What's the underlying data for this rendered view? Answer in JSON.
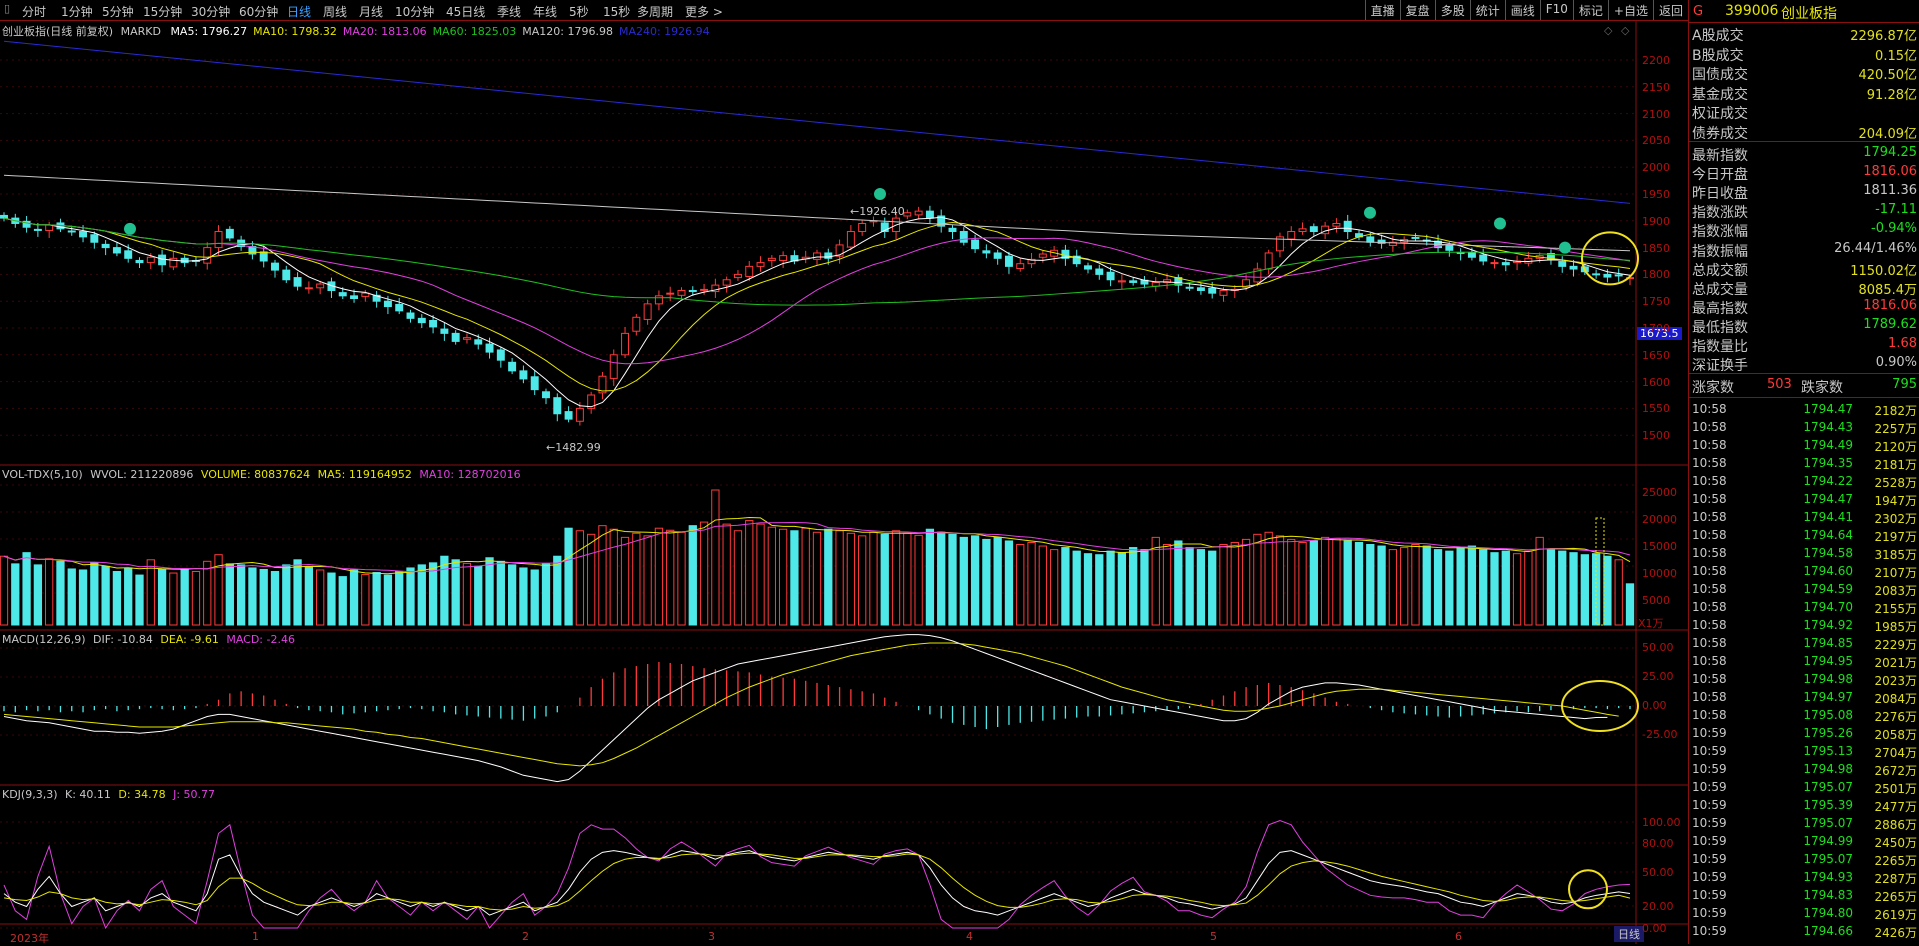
{
  "topbar": {
    "timeframes": [
      "分时",
      "1分钟",
      "5分钟",
      "15分钟",
      "30分钟",
      "60分钟",
      "日线",
      "周线",
      "月线",
      "10分钟",
      "45日线",
      "季线",
      "年线",
      "5秒",
      "15秒",
      "多周期",
      "更多 >"
    ],
    "selected": "日线",
    "tools": [
      "直播",
      "复盘",
      "多股",
      "统计",
      "画线",
      "F10",
      "标记",
      "+自选",
      "返回"
    ]
  },
  "main": {
    "title": "创业板指(日线 前复权)",
    "indicator": "MARKD",
    "ma": [
      {
        "label": "MA5: 1796.27",
        "color": "#ffffff"
      },
      {
        "label": "MA10: 1798.32",
        "color": "#e6e600"
      },
      {
        "label": "MA20: 1813.06",
        "color": "#e040e0"
      },
      {
        "label": "MA60: 1825.03",
        "color": "#20c020"
      },
      {
        "label": "MA120: 1796.98",
        "color": "#c8c8c8"
      },
      {
        "label": "MA240: 1926.94",
        "color": "#2a2ad0"
      }
    ],
    "y_ticks": [
      "2200",
      "2150",
      "2100",
      "2050",
      "2000",
      "1950",
      "1900",
      "1850",
      "1800",
      "1750",
      "1700",
      "1650",
      "1600",
      "1550",
      "1500"
    ],
    "high_label": "1926.40",
    "low_label": "1482.99",
    "cursor_price": "1673.5"
  },
  "vol": {
    "title": "VOL-TDX(5,10)",
    "wvol": "WVOL: 211220896",
    "volume": "VOLUME: 80837624",
    "ma5": "MA5: 119164952",
    "ma10": "MA10: 128702016",
    "y_ticks": [
      "25000",
      "20000",
      "15000",
      "10000",
      "5000"
    ],
    "unit": "X1万"
  },
  "macd": {
    "title": "MACD(12,26,9)",
    "dif": "DIF: -10.84",
    "dea": "DEA: -9.61",
    "macd": "MACD: -2.46",
    "y_ticks": [
      "50.00",
      "25.00",
      "0.00",
      "-25.00"
    ]
  },
  "kdj": {
    "title": "KDJ(9,3,3)",
    "k": "K: 40.11",
    "d": "D: 34.78",
    "j": "J: 50.77",
    "y_ticks": [
      "100.00",
      "80.00",
      "50.00",
      "20.00",
      "0.00"
    ]
  },
  "xaxis": {
    "labels": [
      "2023年",
      "1",
      "2",
      "3",
      "4",
      "5",
      "6"
    ]
  },
  "bottom": {
    "tab": "日线"
  },
  "side": {
    "badge": "G",
    "code": "399006",
    "name": "创业板指",
    "rows1": [
      {
        "k": "A股成交",
        "v": "2296.87亿",
        "c": "#e0e020"
      },
      {
        "k": "B股成交",
        "v": "0.15亿",
        "c": "#e0e020"
      },
      {
        "k": "国债成交",
        "v": "420.50亿",
        "c": "#e0e020"
      },
      {
        "k": "基金成交",
        "v": "91.28亿",
        "c": "#e0e020"
      },
      {
        "k": "权证成交",
        "v": "",
        "c": "#e0e020"
      },
      {
        "k": "债券成交",
        "v": "204.09亿",
        "c": "#e0e020"
      }
    ],
    "rows2": [
      {
        "k": "最新指数",
        "v": "1794.25",
        "c": "#1de01d"
      },
      {
        "k": "今日开盘",
        "v": "1816.06",
        "c": "#ff3a3a"
      },
      {
        "k": "昨日收盘",
        "v": "1811.36",
        "c": "#c8c8c8"
      },
      {
        "k": "指数涨跌",
        "v": "-17.11",
        "c": "#1de01d"
      },
      {
        "k": "指数涨幅",
        "v": "-0.94%",
        "c": "#1de01d"
      },
      {
        "k": "指数振幅",
        "v": "26.44/1.46%",
        "c": "#c8c8c8"
      },
      {
        "k": "总成交额",
        "v": "1150.02亿",
        "c": "#e0e020"
      },
      {
        "k": "总成交量",
        "v": "8085.4万",
        "c": "#e0e020"
      },
      {
        "k": "最高指数",
        "v": "1816.06",
        "c": "#ff3a3a"
      },
      {
        "k": "最低指数",
        "v": "1789.62",
        "c": "#1de01d"
      },
      {
        "k": "指数量比",
        "v": "1.68",
        "c": "#ff3a3a"
      },
      {
        "k": "深证换手",
        "v": "0.90%",
        "c": "#c8c8c8"
      }
    ],
    "updown": {
      "up_label": "涨家数",
      "up": "503",
      "down_label": "跌家数",
      "down": "795"
    },
    "ticks": [
      {
        "t": "10:58",
        "p": "1794.47",
        "q": "2182万"
      },
      {
        "t": "10:58",
        "p": "1794.43",
        "q": "2257万"
      },
      {
        "t": "10:58",
        "p": "1794.49",
        "q": "2120万"
      },
      {
        "t": "10:58",
        "p": "1794.35",
        "q": "2181万"
      },
      {
        "t": "10:58",
        "p": "1794.22",
        "q": "2528万"
      },
      {
        "t": "10:58",
        "p": "1794.47",
        "q": "1947万"
      },
      {
        "t": "10:58",
        "p": "1794.41",
        "q": "2302万"
      },
      {
        "t": "10:58",
        "p": "1794.64",
        "q": "2197万"
      },
      {
        "t": "10:58",
        "p": "1794.58",
        "q": "3185万"
      },
      {
        "t": "10:58",
        "p": "1794.60",
        "q": "2107万"
      },
      {
        "t": "10:58",
        "p": "1794.59",
        "q": "2083万"
      },
      {
        "t": "10:58",
        "p": "1794.70",
        "q": "2155万"
      },
      {
        "t": "10:58",
        "p": "1794.92",
        "q": "1985万"
      },
      {
        "t": "10:58",
        "p": "1794.85",
        "q": "2229万"
      },
      {
        "t": "10:58",
        "p": "1794.95",
        "q": "2021万"
      },
      {
        "t": "10:58",
        "p": "1794.98",
        "q": "2023万"
      },
      {
        "t": "10:58",
        "p": "1794.97",
        "q": "2084万"
      },
      {
        "t": "10:58",
        "p": "1795.08",
        "q": "2276万"
      },
      {
        "t": "10:59",
        "p": "1795.26",
        "q": "2058万"
      },
      {
        "t": "10:59",
        "p": "1795.13",
        "q": "2704万"
      },
      {
        "t": "10:59",
        "p": "1794.98",
        "q": "2672万"
      },
      {
        "t": "10:59",
        "p": "1795.07",
        "q": "2501万"
      },
      {
        "t": "10:59",
        "p": "1795.39",
        "q": "2477万"
      },
      {
        "t": "10:59",
        "p": "1795.07",
        "q": "2886万"
      },
      {
        "t": "10:59",
        "p": "1794.99",
        "q": "2450万"
      },
      {
        "t": "10:59",
        "p": "1795.07",
        "q": "2265万"
      },
      {
        "t": "10:59",
        "p": "1794.93",
        "q": "2287万"
      },
      {
        "t": "10:59",
        "p": "1794.83",
        "q": "2265万"
      },
      {
        "t": "10:59",
        "p": "1794.80",
        "q": "2619万"
      },
      {
        "t": "10:59",
        "p": "1794.66",
        "q": "2426万"
      }
    ]
  },
  "chart_data": {
    "type": "candlestick",
    "title": "创业板指(日线 前复权)",
    "ylim": [
      1480,
      2220
    ],
    "closes": [
      1905,
      1895,
      1888,
      1882,
      1892,
      1885,
      1880,
      1870,
      1860,
      1850,
      1840,
      1830,
      1822,
      1832,
      1818,
      1830,
      1822,
      1825,
      1850,
      1880,
      1868,
      1852,
      1838,
      1825,
      1808,
      1790,
      1778,
      1775,
      1782,
      1770,
      1760,
      1755,
      1765,
      1750,
      1740,
      1732,
      1718,
      1710,
      1702,
      1690,
      1675,
      1682,
      1670,
      1655,
      1640,
      1620,
      1605,
      1585,
      1570,
      1540,
      1530,
      1550,
      1575,
      1610,
      1650,
      1690,
      1720,
      1745,
      1760,
      1765,
      1770,
      1768,
      1772,
      1780,
      1790,
      1800,
      1815,
      1822,
      1830,
      1835,
      1825,
      1832,
      1840,
      1830,
      1855,
      1880,
      1895,
      1900,
      1880,
      1905,
      1915,
      1918,
      1905,
      1890,
      1880,
      1860,
      1848,
      1840,
      1830,
      1815,
      1820,
      1828,
      1838,
      1845,
      1830,
      1820,
      1810,
      1800,
      1790,
      1788,
      1785,
      1782,
      1785,
      1790,
      1780,
      1775,
      1770,
      1765,
      1770,
      1772,
      1790,
      1810,
      1840,
      1870,
      1880,
      1885,
      1880,
      1890,
      1895,
      1880,
      1870,
      1860,
      1858,
      1860,
      1865,
      1868,
      1862,
      1850,
      1845,
      1840,
      1832,
      1825,
      1822,
      1818,
      1825,
      1830,
      1835,
      1828,
      1815,
      1810,
      1805,
      1800,
      1795,
      1798,
      1794
    ],
    "opens_offset_note": "",
    "ma_colors": [
      "#ffffff",
      "#e6e600",
      "#e040e0",
      "#20c020",
      "#c8c8c8",
      "#2a2ad0"
    ],
    "volumes": [
      13500,
      12000,
      14200,
      11800,
      13000,
      12500,
      11000,
      10800,
      12200,
      11500,
      10500,
      11200,
      9800,
      12800,
      10900,
      10200,
      11000,
      10500,
      12500,
      13800,
      12000,
      11800,
      11200,
      10900,
      10500,
      11800,
      12800,
      11500,
      10800,
      10200,
      9500,
      10800,
      9900,
      10300,
      9800,
      10500,
      11200,
      11800,
      12200,
      13500,
      12800,
      12100,
      11500,
      13200,
      12500,
      11800,
      11200,
      10800,
      12000,
      13500,
      19000,
      18500,
      17800,
      19500,
      18800,
      17200,
      18000,
      17500,
      19000,
      18600,
      18200,
      19500,
      20200,
      26500,
      19800,
      18500,
      20500,
      19800,
      19200,
      18800,
      18500,
      19000,
      18200,
      18800,
      18500,
      18000,
      17500,
      18200,
      17800,
      18500,
      18000,
      17600,
      18800,
      18200,
      17800,
      17200,
      17500,
      16800,
      17200,
      16500,
      15800,
      16200,
      15500,
      14800,
      15200,
      14500,
      14000,
      13800,
      14500,
      14200,
      15200,
      14800,
      17200,
      15800,
      16500,
      15200,
      14800,
      14500,
      15800,
      16200,
      16800,
      17800,
      18200,
      17500,
      16800,
      16200,
      16500,
      17200,
      17000,
      16500,
      16200,
      15800,
      15500,
      14800,
      15200,
      15800,
      15500,
      14800,
      14500,
      15200,
      15500,
      14800,
      14200,
      14500,
      14000,
      14500,
      17200,
      14800,
      14500,
      14200,
      13800,
      14000,
      13500,
      12800,
      8083
    ],
    "macd_hist": [
      -5,
      -6,
      -4,
      -5,
      -4,
      -6,
      -5,
      -6,
      -4,
      -3,
      -5,
      -4,
      -3,
      -2,
      -3,
      -4,
      -3,
      -2,
      2,
      6,
      12,
      14,
      12,
      10,
      6,
      2,
      -2,
      -4,
      -5,
      -6,
      -8,
      -7,
      -6,
      -5,
      -4,
      -3,
      -2,
      -3,
      -5,
      -6,
      -8,
      -9,
      -10,
      -11,
      -12,
      -13,
      -14,
      -12,
      -10,
      -6,
      0,
      8,
      18,
      26,
      32,
      36,
      38,
      40,
      42,
      41,
      40,
      38,
      36,
      35,
      34,
      33,
      32,
      30,
      28,
      27,
      26,
      24,
      22,
      20,
      18,
      16,
      14,
      12,
      8,
      4,
      0,
      -4,
      -8,
      -12,
      -16,
      -18,
      -20,
      -22,
      -20,
      -18,
      -16,
      -15,
      -14,
      -13,
      -12,
      -11,
      -10,
      -10,
      -9,
      -8,
      -7,
      -6,
      -5,
      -4,
      -3,
      -2,
      2,
      6,
      10,
      14,
      18,
      20,
      22,
      20,
      18,
      15,
      12,
      8,
      4,
      2,
      0,
      -2,
      -4,
      -6,
      -7,
      -8,
      -9,
      -10,
      -11,
      -10,
      -9,
      -8,
      -7,
      -6,
      -5,
      -6,
      -5,
      -4,
      -3,
      -3,
      -2,
      -2,
      -3,
      -2,
      -3,
      -2,
      -2,
      -2,
      -2.46
    ],
    "dif": [
      -10,
      -12,
      -14,
      -15,
      -16,
      -18,
      -20,
      -22,
      -24,
      -24,
      -25,
      -25,
      -26,
      -25,
      -24,
      -22,
      -18,
      -14,
      -10,
      -8,
      -8,
      -10,
      -12,
      -14,
      -16,
      -18,
      -20,
      -22,
      -24,
      -26,
      -28,
      -30,
      -32,
      -34,
      -36,
      -38,
      -40,
      -42,
      -44,
      -46,
      -48,
      -50,
      -52,
      -55,
      -58,
      -62,
      -66,
      -68,
      -70,
      -72,
      -70,
      -62,
      -52,
      -42,
      -32,
      -22,
      -12,
      -2,
      6,
      12,
      18,
      24,
      28,
      32,
      36,
      40,
      42,
      44,
      46,
      48,
      50,
      52,
      54,
      56,
      58,
      60,
      62,
      64,
      66,
      67,
      68,
      68,
      67,
      65,
      62,
      58,
      54,
      50,
      46,
      42,
      38,
      34,
      30,
      26,
      22,
      18,
      14,
      10,
      6,
      4,
      2,
      0,
      -2,
      -4,
      -6,
      -8,
      -10,
      -12,
      -14,
      -14,
      -12,
      -6,
      2,
      8,
      14,
      18,
      20,
      22,
      22,
      21,
      20,
      18,
      16,
      14,
      12,
      10,
      8,
      6,
      4,
      2,
      0,
      -2,
      -4,
      -5,
      -6,
      -7,
      -8,
      -9,
      -10,
      -11,
      -12,
      -11,
      -10.84
    ],
    "dea": [
      -8,
      -9,
      -10,
      -11,
      -12,
      -13,
      -14,
      -15,
      -16,
      -17,
      -18,
      -19,
      -20,
      -20,
      -20,
      -20,
      -19,
      -18,
      -17,
      -16,
      -15,
      -15,
      -15,
      -15,
      -16,
      -16,
      -17,
      -18,
      -19,
      -20,
      -21,
      -22,
      -24,
      -25,
      -27,
      -28,
      -30,
      -31,
      -33,
      -35,
      -37,
      -39,
      -41,
      -43,
      -45,
      -47,
      -49,
      -51,
      -53,
      -55,
      -56,
      -57,
      -56,
      -54,
      -50,
      -45,
      -40,
      -34,
      -28,
      -22,
      -16,
      -10,
      -4,
      2,
      8,
      13,
      18,
      22,
      26,
      30,
      33,
      36,
      39,
      42,
      45,
      48,
      50,
      52,
      54,
      56,
      58,
      59,
      60,
      60,
      60,
      59,
      58,
      56,
      54,
      52,
      50,
      47,
      44,
      41,
      38,
      34,
      30,
      26,
      22,
      18,
      15,
      12,
      9,
      6,
      4,
      2,
      0,
      -2,
      -4,
      -5,
      -5,
      -4,
      -2,
      0,
      3,
      6,
      9,
      12,
      14,
      15,
      16,
      16,
      16,
      15,
      14,
      13,
      12,
      11,
      10,
      9,
      8,
      7,
      6,
      5,
      4,
      3,
      2,
      1,
      0,
      -2,
      -4,
      -6,
      -8,
      -9.61
    ],
    "k": [
      40,
      30,
      25,
      45,
      60,
      40,
      25,
      30,
      35,
      20,
      25,
      30,
      25,
      35,
      40,
      30,
      25,
      20,
      40,
      80,
      85,
      60,
      40,
      30,
      25,
      20,
      15,
      25,
      30,
      35,
      30,
      25,
      30,
      40,
      35,
      30,
      25,
      30,
      25,
      30,
      25,
      20,
      25,
      15,
      20,
      25,
      30,
      20,
      25,
      30,
      45,
      65,
      80,
      88,
      90,
      88,
      85,
      82,
      80,
      85,
      90,
      88,
      85,
      80,
      85,
      88,
      90,
      85,
      82,
      80,
      78,
      82,
      85,
      88,
      86,
      84,
      82,
      80,
      84,
      86,
      88,
      85,
      70,
      50,
      35,
      25,
      20,
      18,
      15,
      20,
      25,
      30,
      35,
      40,
      35,
      30,
      25,
      28,
      35,
      40,
      45,
      40,
      38,
      35,
      30,
      28,
      25,
      22,
      25,
      28,
      35,
      55,
      75,
      88,
      90,
      85,
      80,
      75,
      70,
      65,
      60,
      55,
      52,
      50,
      48,
      45,
      42,
      40,
      35,
      30,
      28,
      25,
      30,
      35,
      40,
      38,
      35,
      30,
      28,
      30,
      35,
      38,
      40,
      42,
      40.11
    ],
    "d": [
      35,
      33,
      32,
      36,
      42,
      40,
      35,
      33,
      34,
      30,
      28,
      29,
      27,
      30,
      33,
      32,
      30,
      27,
      32,
      48,
      58,
      58,
      52,
      44,
      38,
      32,
      27,
      26,
      27,
      30,
      30,
      28,
      29,
      33,
      34,
      33,
      30,
      30,
      28,
      29,
      27,
      25,
      25,
      22,
      21,
      22,
      25,
      23,
      24,
      26,
      32,
      43,
      55,
      66,
      75,
      80,
      82,
      82,
      81,
      82,
      85,
      86,
      86,
      84,
      84,
      86,
      87,
      86,
      85,
      83,
      81,
      81,
      83,
      85,
      85,
      85,
      84,
      83,
      83,
      84,
      86,
      85,
      80,
      70,
      58,
      47,
      38,
      31,
      26,
      24,
      24,
      26,
      29,
      33,
      34,
      33,
      30,
      29,
      31,
      34,
      38,
      39,
      38,
      37,
      35,
      32,
      30,
      27,
      26,
      27,
      29,
      38,
      50,
      63,
      72,
      76,
      78,
      77,
      75,
      72,
      68,
      64,
      60,
      57,
      54,
      51,
      48,
      45,
      42,
      38,
      35,
      32,
      31,
      32,
      35,
      36,
      36,
      34,
      32,
      31,
      32,
      34,
      36,
      38,
      34.78
    ],
    "j": [
      50,
      20,
      10,
      60,
      95,
      40,
      5,
      25,
      35,
      0,
      20,
      32,
      20,
      45,
      55,
      25,
      15,
      5,
      55,
      110,
      120,
      65,
      15,
      0,
      0,
      0,
      0,
      20,
      35,
      45,
      30,
      20,
      30,
      55,
      35,
      25,
      15,
      30,
      20,
      30,
      20,
      10,
      25,
      0,
      15,
      30,
      40,
      15,
      25,
      40,
      70,
      110,
      120,
      115,
      115,
      105,
      92,
      82,
      78,
      92,
      100,
      92,
      82,
      72,
      87,
      92,
      96,
      83,
      76,
      74,
      72,
      84,
      89,
      94,
      88,
      82,
      78,
      74,
      86,
      90,
      92,
      85,
      50,
      10,
      0,
      0,
      0,
      0,
      0,
      10,
      27,
      38,
      47,
      55,
      37,
      24,
      15,
      27,
      43,
      52,
      59,
      42,
      38,
      31,
      20,
      20,
      15,
      12,
      22,
      30,
      48,
      88,
      120,
      125,
      120,
      100,
      85,
      70,
      60,
      50,
      44,
      38,
      36,
      35,
      35,
      33,
      30,
      30,
      20,
      15,
      15,
      12,
      28,
      40,
      50,
      42,
      33,
      22,
      20,
      28,
      40,
      45,
      48,
      50,
      50.77
    ]
  }
}
